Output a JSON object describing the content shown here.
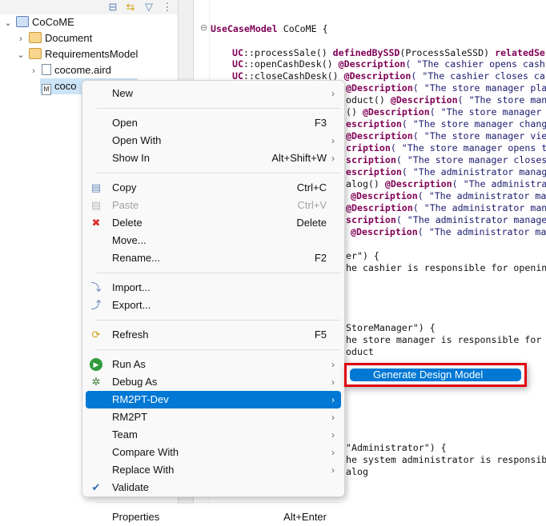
{
  "explorer": {
    "toolbar": [
      "collapse-all-icon",
      "link-with-editor-icon",
      "filter-icon",
      "view-menu-icon"
    ],
    "tree": [
      {
        "label": "CoCoME",
        "icon": "project-icon",
        "expanded": true
      },
      {
        "label": "Document",
        "icon": "folder-icon",
        "expanded": false
      },
      {
        "label": "RequirementsModel",
        "icon": "folder-icon",
        "expanded": true
      },
      {
        "label": "cocome.aird",
        "icon": "aird-file-icon",
        "expanded": false
      },
      {
        "label": "coco",
        "icon": "model-file-icon",
        "selected": true
      }
    ]
  },
  "editor": {
    "lines": [
      [
        {
          "t": "UseCaseModel",
          "k": 1
        },
        {
          "t": " CoCoME {"
        }
      ],
      [
        {
          "t": "UC",
          "k": 1
        },
        {
          "t": "::processSale() "
        },
        {
          "t": "definedBySSD",
          "k": 1
        },
        {
          "t": "(ProcessSaleSSD) "
        },
        {
          "t": "relatedSe",
          "k": 1
        }
      ],
      [
        {
          "t": "UC",
          "k": 1
        },
        {
          "t": "::openCashDesk() "
        },
        {
          "t": "@Description",
          "k": 1
        },
        {
          "t": "( \"The cashier opens cash",
          "s": 1
        }
      ],
      [
        {
          "t": "UC",
          "k": 1
        },
        {
          "t": "::closeCashDesk() "
        },
        {
          "t": "@Description",
          "k": 1
        },
        {
          "t": "( \"The cashier closes ca",
          "s": 1
        }
      ],
      [
        {
          "t": "@Description",
          "k": 1
        },
        {
          "t": "( \"The store manager pla",
          "s": 1
        }
      ],
      [
        {
          "t": "oduct() "
        },
        {
          "t": "@Description",
          "k": 1
        },
        {
          "t": "( \"The store man",
          "s": 1
        }
      ],
      [
        {
          "t": "() "
        },
        {
          "t": "@Description",
          "k": 1
        },
        {
          "t": "( \"The store manager ",
          "s": 1
        }
      ],
      [
        {
          "t": "escription",
          "k": 1
        },
        {
          "t": "( \"The store manager chang",
          "s": 1
        }
      ],
      [
        {
          "t": "@Description",
          "k": 1
        },
        {
          "t": "( \"The store manager vie",
          "s": 1
        }
      ],
      [
        {
          "t": "cription",
          "k": 1
        },
        {
          "t": "( \"The store manager opens t",
          "s": 1
        }
      ],
      [
        {
          "t": "scription",
          "k": 1
        },
        {
          "t": "( \"The store manager closes",
          "s": 1
        }
      ],
      [
        {
          "t": "escription",
          "k": 1
        },
        {
          "t": "( \"The administrator manag",
          "s": 1
        }
      ],
      [
        {
          "t": "alog() "
        },
        {
          "t": "@Description",
          "k": 1
        },
        {
          "t": "( \"The administra",
          "s": 1
        }
      ],
      [
        {
          "t": "@Description",
          "k": 1
        },
        {
          "t": "( \"The administrator ma",
          "s": 1
        }
      ],
      [
        {
          "t": "@Description",
          "k": 1
        },
        {
          "t": "( \"The administrator man",
          "s": 1
        }
      ],
      [
        {
          "t": "scription",
          "k": 1
        },
        {
          "t": "( \"The administrator manage",
          "s": 1
        }
      ],
      [
        {
          "t": "@Description",
          "k": 1
        },
        {
          "t": "( \"The administrator ma",
          "s": 1
        }
      ],
      [
        {
          "t": "er\") {"
        }
      ],
      [
        {
          "t": "he cashier is responsible for openin"
        }
      ],
      [
        {
          "t": "StoreManager\") {"
        }
      ],
      [
        {
          "t": "he store manager is responsible for "
        }
      ],
      [
        {
          "t": "oduct"
        }
      ],
      [
        {
          "t": "\"Administrator\") {"
        }
      ],
      [
        {
          "t": "he system administrator is responsib"
        }
      ],
      [
        {
          "t": "alog"
        }
      ]
    ]
  },
  "context_menu": {
    "items": [
      {
        "label": "New",
        "arrow": true
      },
      {
        "sep": true
      },
      {
        "label": "Open",
        "shortcut": "F3"
      },
      {
        "label": "Open With",
        "arrow": true
      },
      {
        "label": "Show In",
        "shortcut": "Alt+Shift+W",
        "arrow": true
      },
      {
        "sep": true
      },
      {
        "label": "Copy",
        "shortcut": "Ctrl+C",
        "icon": "copy-icon"
      },
      {
        "label": "Paste",
        "shortcut": "Ctrl+V",
        "icon": "paste-icon",
        "disabled": true
      },
      {
        "label": "Delete",
        "shortcut": "Delete",
        "icon": "delete-icon"
      },
      {
        "label": "Move..."
      },
      {
        "label": "Rename...",
        "shortcut": "F2"
      },
      {
        "sep": true
      },
      {
        "label": "Import...",
        "icon": "import-icon"
      },
      {
        "label": "Export...",
        "icon": "export-icon"
      },
      {
        "sep": true
      },
      {
        "label": "Refresh",
        "shortcut": "F5",
        "icon": "refresh-icon"
      },
      {
        "sep": true
      },
      {
        "label": "Run As",
        "arrow": true,
        "icon": "run-icon"
      },
      {
        "label": "Debug As",
        "arrow": true,
        "icon": "debug-icon"
      },
      {
        "label": "RM2PT-Dev",
        "arrow": true,
        "highlighted": true
      },
      {
        "label": "RM2PT",
        "arrow": true
      },
      {
        "label": "Team",
        "arrow": true
      },
      {
        "label": "Compare With",
        "arrow": true
      },
      {
        "label": "Replace With",
        "arrow": true
      },
      {
        "label": "Validate",
        "icon": "checkbox-checked-icon"
      },
      {
        "sep": true
      },
      {
        "label": "Properties",
        "shortcut": "Alt+Enter"
      }
    ]
  },
  "submenu": {
    "items": [
      {
        "label": "Generate Design Model",
        "highlighted": true
      }
    ]
  },
  "colors": {
    "highlight": "#0078d4",
    "annotation_box": "#e0000f",
    "keyword": "#7f0055"
  }
}
